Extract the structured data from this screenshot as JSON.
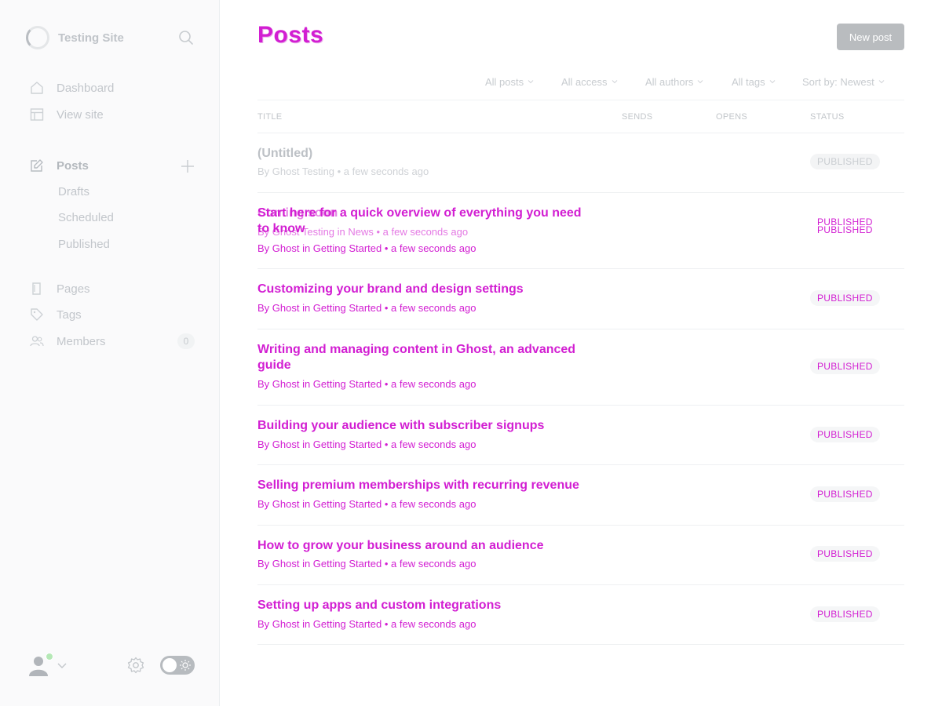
{
  "brand": {
    "name": "Testing Site"
  },
  "sidebar": {
    "nav": [
      {
        "label": "Dashboard",
        "icon": "home-icon"
      },
      {
        "label": "View site",
        "icon": "layout-icon"
      }
    ],
    "posts": {
      "label": "Posts",
      "icon": "edit-icon",
      "sub": [
        "Drafts",
        "Scheduled",
        "Published"
      ]
    },
    "secondary": [
      {
        "label": "Pages",
        "icon": "page-icon"
      },
      {
        "label": "Tags",
        "icon": "tag-icon"
      },
      {
        "label": "Members",
        "icon": "members-icon",
        "count": "0"
      }
    ]
  },
  "header": {
    "title": "Posts",
    "new_post_label": "New post"
  },
  "filters": [
    "All posts",
    "All access",
    "All authors",
    "All tags",
    "Sort by: Newest"
  ],
  "columns": {
    "title": "TITLE",
    "sends": "SENDS",
    "opens": "OPENS",
    "status": "STATUS"
  },
  "posts": [
    {
      "title": "(Untitled)",
      "meta": "By Ghost Testing • a few seconds ago",
      "status": "PUBLISHED"
    },
    {
      "title": "Start here for a quick overview of everything you need to know",
      "meta": "By Ghost in Getting Started • a few seconds ago",
      "status": "PUBLISHED"
    },
    {
      "title": "Customizing your brand and design settings",
      "meta": "By Ghost in Getting Started • a few seconds ago",
      "status": "PUBLISHED"
    },
    {
      "title": "Writing and managing content in Ghost, an advanced guide",
      "meta": "By Ghost in Getting Started • a few seconds ago",
      "status": "PUBLISHED"
    },
    {
      "title": "Building your audience with subscriber signups",
      "meta": "By Ghost in Getting Started • a few seconds ago",
      "status": "PUBLISHED"
    },
    {
      "title": "Selling premium memberships with recurring revenue",
      "meta": "By Ghost in Getting Started • a few seconds ago",
      "status": "PUBLISHED"
    },
    {
      "title": "How to grow your business around an audience",
      "meta": "By Ghost in Getting Started • a few seconds ago",
      "status": "PUBLISHED"
    },
    {
      "title": "Setting up apps and custom integrations",
      "meta": "By Ghost in Getting Started • a few seconds ago",
      "status": "PUBLISHED"
    }
  ],
  "overlay": {
    "title": "Coming soon",
    "meta": "By Ghost Testing in News • a few seconds ago",
    "status": "PUBLISHED"
  }
}
